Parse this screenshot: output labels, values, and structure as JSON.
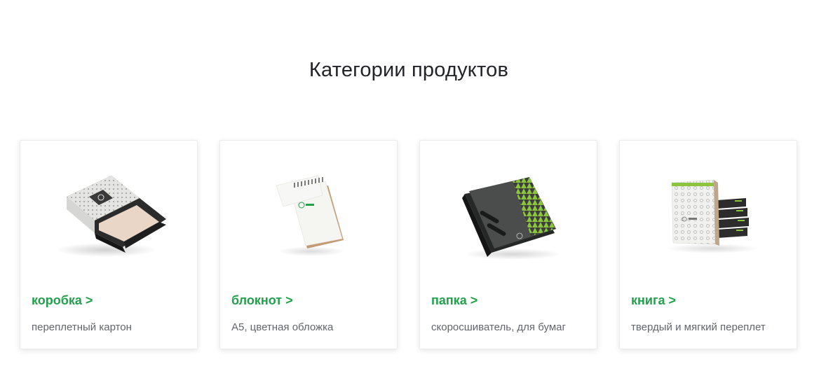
{
  "section": {
    "title": "Категории продуктов"
  },
  "categories": [
    {
      "title": "коробка >",
      "description": "переплетный картон",
      "icon": "box-image"
    },
    {
      "title": "блокнот >",
      "description": "А5, цветная обложка",
      "icon": "notepad-image"
    },
    {
      "title": "папка >",
      "description": "скоросшиватель, для бумаг",
      "icon": "folder-image"
    },
    {
      "title": "книга >",
      "description": "твердый и мягкий переплет",
      "icon": "book-image"
    }
  ],
  "colors": {
    "accent": "#22a04b",
    "text": "#222428",
    "muted": "#62656b"
  }
}
